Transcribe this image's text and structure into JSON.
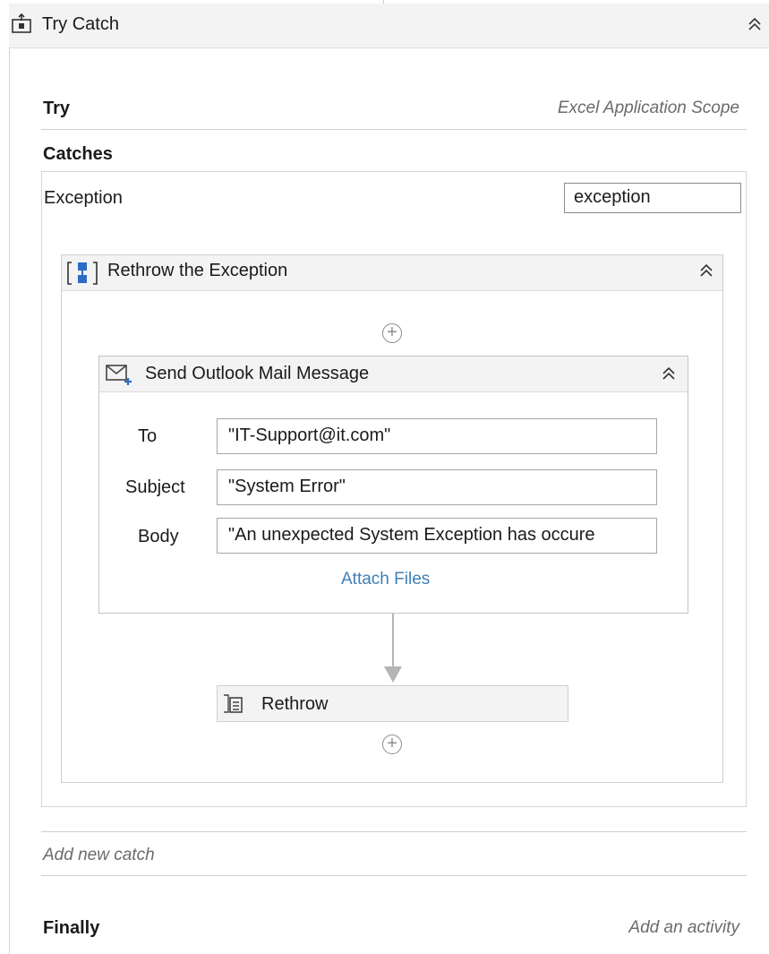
{
  "try_catch": {
    "title": "Try Catch",
    "try_label": "Try",
    "try_activity": "Excel Application Scope",
    "catches_label": "Catches",
    "exception_type": "Exception",
    "exception_variable": "exception",
    "add_new_catch": "Add new catch",
    "finally_label": "Finally",
    "finally_placeholder": "Add an activity"
  },
  "sequence": {
    "title": "Rethrow the Exception"
  },
  "send_mail": {
    "title": "Send Outlook Mail Message",
    "to_label": "To",
    "to_value": "\"IT-Support@it.com\"",
    "subject_label": "Subject",
    "subject_value": "\"System Error\"",
    "body_label": "Body",
    "body_value": "\"An unexpected System Exception has occure",
    "attach_files": "Attach Files"
  },
  "rethrow": {
    "title": "Rethrow"
  },
  "icons": {
    "try_catch": "try-catch-icon",
    "sequence": "sequence-icon",
    "mail": "mail-icon",
    "rethrow": "rethrow-icon",
    "collapse": "collapse-icon",
    "add": "add-activity-icon"
  },
  "colors": {
    "header_bg": "#f3f3f3",
    "border": "#d5d5d5",
    "link": "#3f7fb7"
  }
}
